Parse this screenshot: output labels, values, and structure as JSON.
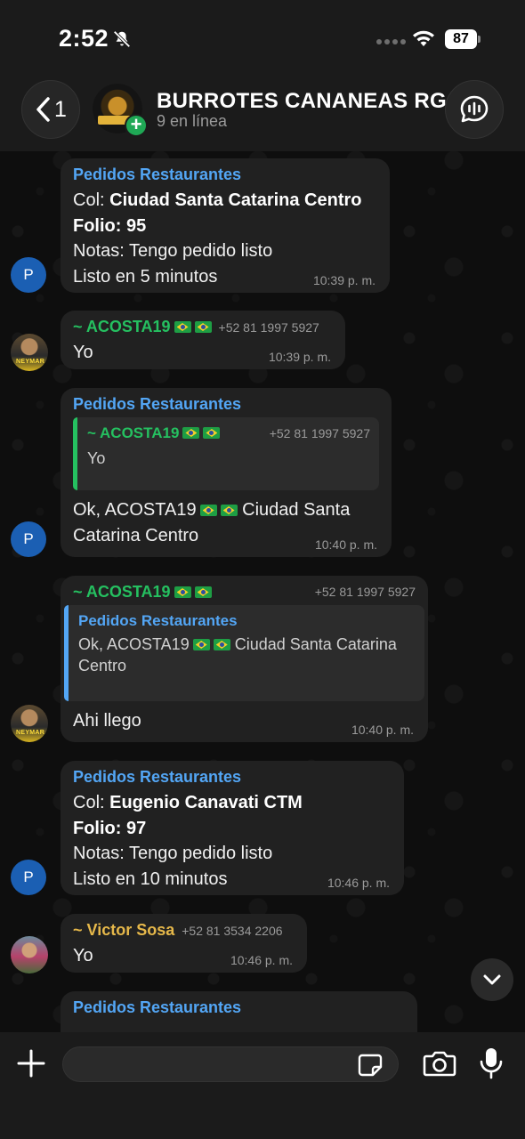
{
  "status_bar": {
    "time": "2:52",
    "battery": "87"
  },
  "header": {
    "back_count": "1",
    "group_name": "BURROTES CANANEAS RG",
    "group_status": "9 en línea",
    "avatar_plus": "+"
  },
  "messages": [
    {
      "sender": "Pedidos Restaurantes",
      "col_label": "Col: ",
      "col_value": "Ciudad Santa Catarina Centro",
      "folio": "Folio: 95",
      "notes": "Notas: Tengo pedido listo",
      "ready": "Listo en 5 minutos",
      "time": "10:39 p. m.",
      "avatar": "P"
    },
    {
      "sender": "~ ACOSTA19",
      "phone": "+52 81 1997 5927",
      "text": "Yo",
      "time": "10:39 p. m.",
      "avatar_tag": "NEYMAR"
    },
    {
      "sender": "Pedidos Restaurantes",
      "quote_sender": "~ ACOSTA19",
      "quote_phone": "+52 81 1997 5927",
      "quote_text": "Yo",
      "text_line1_a": "Ok, ACOSTA19",
      "text_line1_b": "Ciudad Santa",
      "text_line2": "Catarina Centro",
      "time": "10:40 p. m.",
      "avatar": "P"
    },
    {
      "sender": "~ ACOSTA19",
      "phone": "+52 81 1997 5927",
      "quote_sender": "Pedidos Restaurantes",
      "quote_line1_a": "Ok, ACOSTA19",
      "quote_line1_b": "Ciudad Santa Catarina",
      "quote_line2": "Centro",
      "text": "Ahi llego",
      "time": "10:40 p. m.",
      "avatar_tag": "NEYMAR"
    },
    {
      "sender": "Pedidos Restaurantes",
      "col_label": "Col: ",
      "col_value": "Eugenio Canavati CTM",
      "folio": "Folio: 97",
      "notes": "Notas: Tengo pedido listo",
      "ready": "Listo en 10 minutos",
      "time": "10:46 p. m.",
      "avatar": "P"
    },
    {
      "sender": "~ Victor Sosa",
      "phone": "+52 81 3534 2206",
      "text": "Yo",
      "time": "10:46 p. m."
    },
    {
      "sender": "Pedidos Restaurantes"
    }
  ],
  "input": {
    "placeholder": ""
  },
  "colors": {
    "accent_blue": "#53a6f5",
    "accent_green": "#25c060",
    "accent_gold": "#e6b84a",
    "bubble": "#212121"
  },
  "icons": [
    "bell-off-icon",
    "wifi-icon",
    "chevron-left-icon",
    "call-waveform-icon",
    "chevron-down-icon",
    "plus-icon",
    "sticker-icon",
    "camera-icon",
    "microphone-icon"
  ]
}
